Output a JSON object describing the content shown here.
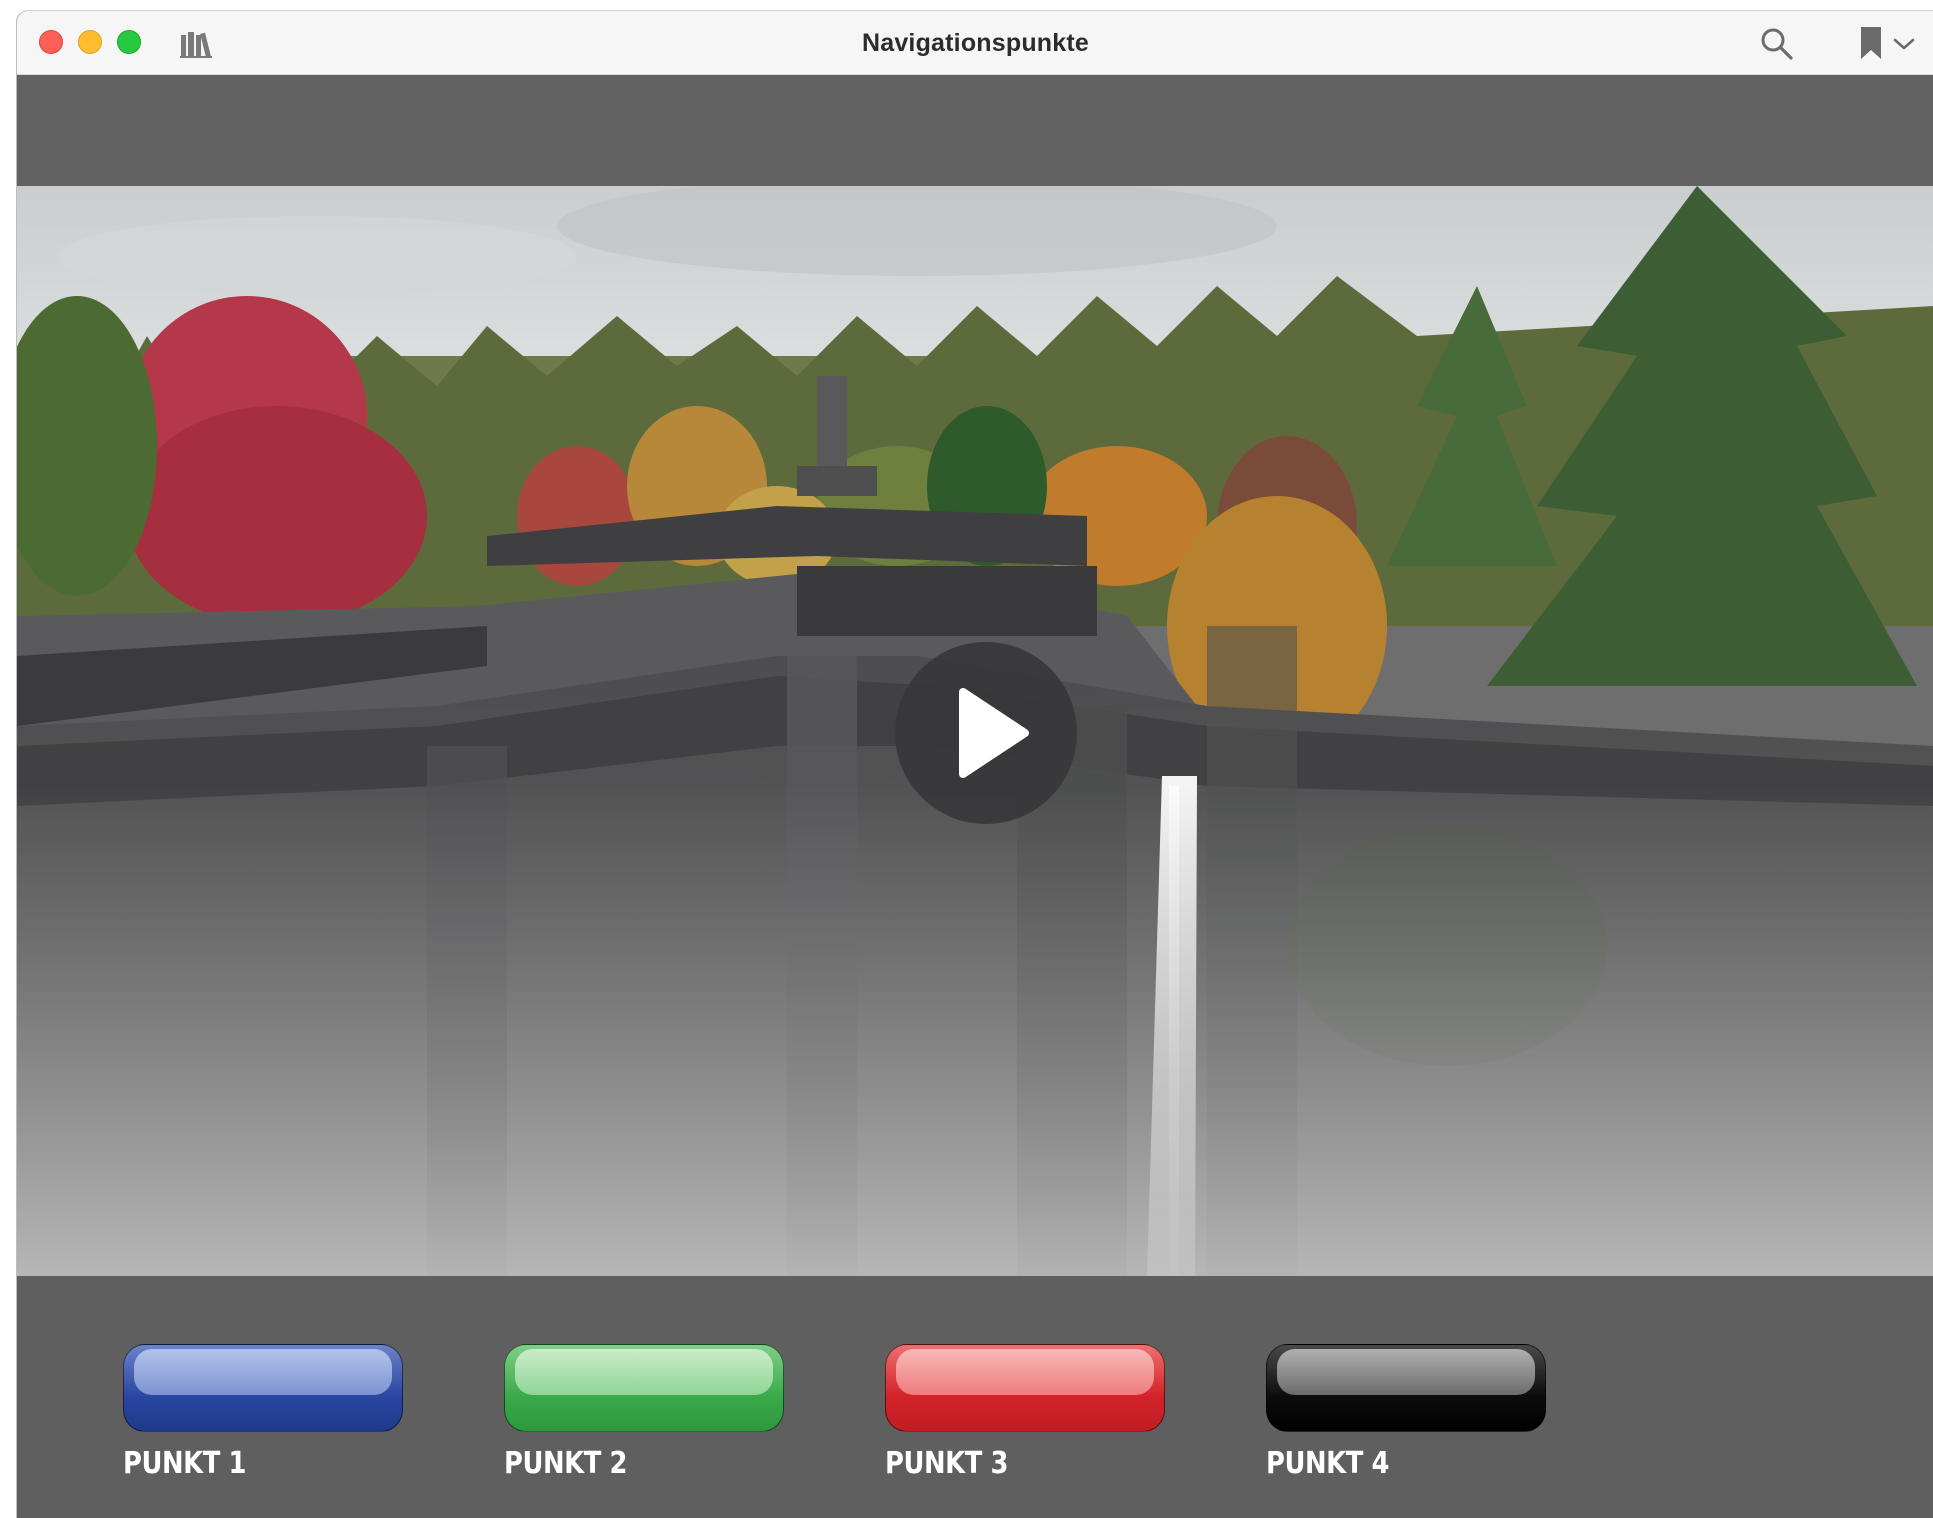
{
  "window": {
    "title": "Navigationspunkte",
    "controls": [
      "close",
      "minimize",
      "maximize"
    ],
    "toolbar_icons": [
      "library-icon",
      "search-icon",
      "bookmark-icon",
      "chevron-down-icon"
    ]
  },
  "video": {
    "state": "paused",
    "control_icon": "play-icon"
  },
  "navigation": {
    "buttons": [
      {
        "label": "PUNKT 1",
        "color": "#2f4fa8"
      },
      {
        "label": "PUNKT 2",
        "color": "#43b04f"
      },
      {
        "label": "PUNKT 3",
        "color": "#d6262c"
      },
      {
        "label": "PUNKT 4",
        "color": "#1a1a1a"
      }
    ]
  },
  "colors": {
    "background": "#5f5f5f",
    "titlebar": "#f6f6f6"
  }
}
